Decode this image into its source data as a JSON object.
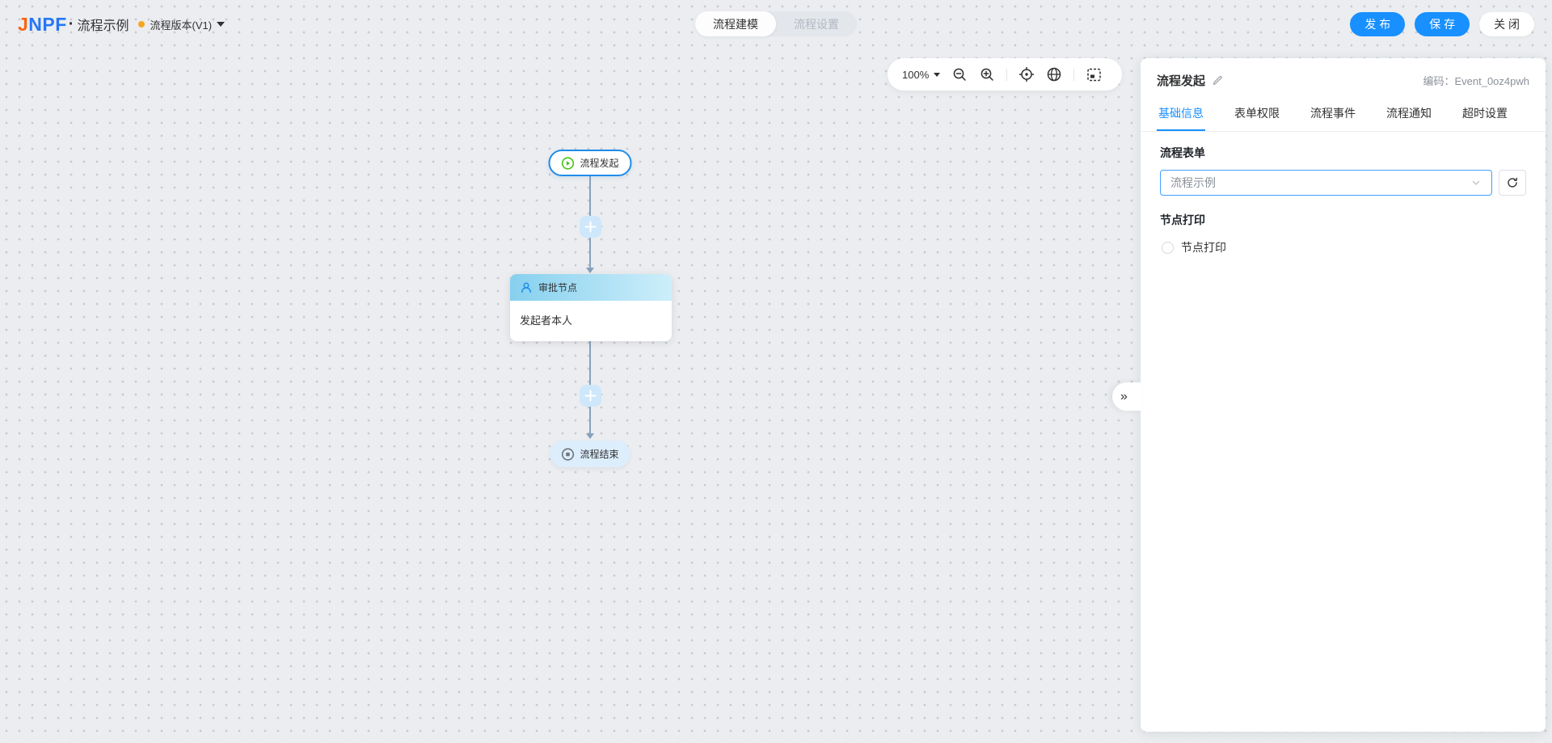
{
  "header": {
    "logo": "JNPF",
    "logo_parts": {
      "j": "J",
      "npf": "NPF"
    },
    "logo_dot": "·",
    "title": "流程示例",
    "version_label": "流程版本(V1)",
    "mode_tabs": [
      {
        "label": "流程建模",
        "active": true
      },
      {
        "label": "流程设置",
        "active": false
      }
    ],
    "publish_label": "发 布",
    "save_label": "保 存",
    "close_label": "关 闭"
  },
  "canvas_toolbar": {
    "zoom_level": "100%",
    "icons": [
      "zoom-out",
      "zoom-in",
      "locate-center",
      "fit-view",
      "minimap"
    ]
  },
  "flow": {
    "start_node": {
      "label": "流程发起",
      "icon": "play-circle"
    },
    "approval_node": {
      "title": "审批节点",
      "icon": "person",
      "assignee": "发起者本人"
    },
    "end_node": {
      "label": "流程结束",
      "icon": "stop-circle"
    }
  },
  "panel": {
    "title": "流程发起",
    "edit_icon": "pencil",
    "code_label": "编码：",
    "code_value": "Event_0oz4pwh",
    "tabs": [
      "基础信息",
      "表单权限",
      "流程事件",
      "流程通知",
      "超时设置"
    ],
    "active_tab": "基础信息",
    "form_section_label": "流程表单",
    "form_select_value": "流程示例",
    "print_section_label": "节点打印",
    "print_checkbox_label": "节点打印",
    "print_checkbox_checked": false,
    "collapse_icon": "»"
  },
  "colors": {
    "primary_blue": "#1890ff",
    "select_border_blue": "#409eff",
    "start_node_border": "#1f8ceb",
    "start_icon_green": "#49c41b",
    "version_dot_orange": "#f6a623",
    "connector": "#87a1bd",
    "approval_header_gradient": [
      "#86d0ee",
      "#cdeefa"
    ],
    "end_node_bg": "#dcedfb",
    "canvas_bg": "#ebedf0",
    "canvas_dot": "#c7cace"
  }
}
